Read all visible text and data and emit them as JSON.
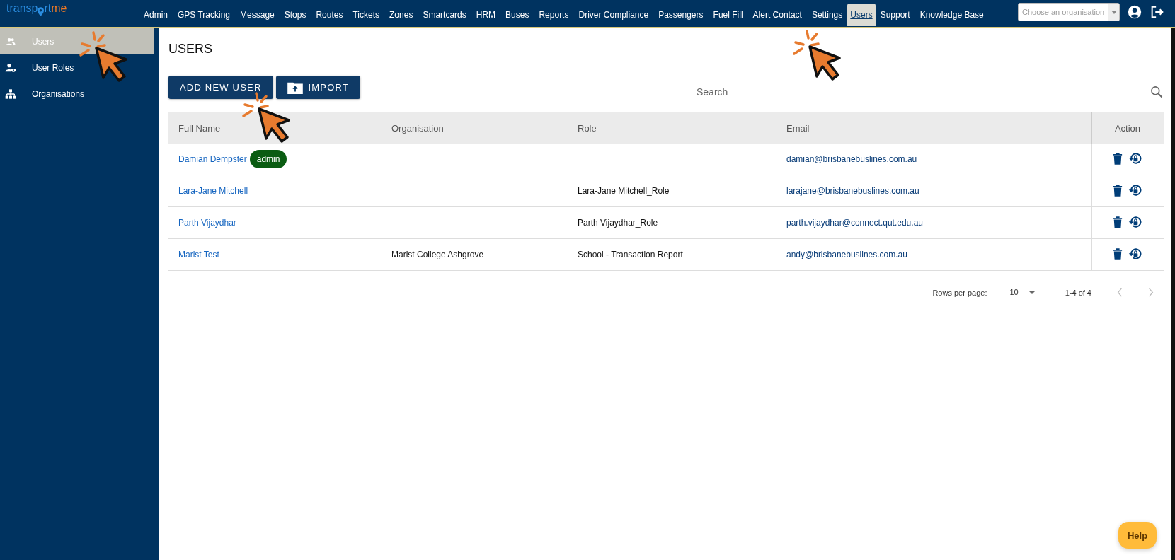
{
  "logo": {
    "part1": "transp",
    "part2": "rt",
    "part3": "me"
  },
  "nav": [
    {
      "label": "Admin",
      "selected": false
    },
    {
      "label": "GPS Tracking",
      "selected": false
    },
    {
      "label": "Message",
      "selected": false
    },
    {
      "label": "Stops",
      "selected": false
    },
    {
      "label": "Routes",
      "selected": false
    },
    {
      "label": "Tickets",
      "selected": false
    },
    {
      "label": "Zones",
      "selected": false
    },
    {
      "label": "Smartcards",
      "selected": false
    },
    {
      "label": "HRM",
      "selected": false
    },
    {
      "label": "Buses",
      "selected": false
    },
    {
      "label": "Reports",
      "selected": false
    },
    {
      "label": "Driver Compliance",
      "selected": false
    },
    {
      "label": "Passengers",
      "selected": false
    },
    {
      "label": "Fuel Fill",
      "selected": false
    },
    {
      "label": "Alert Contact",
      "selected": false
    },
    {
      "label": "Settings",
      "selected": false
    },
    {
      "label": "Users",
      "selected": true
    },
    {
      "label": "Support",
      "selected": false
    },
    {
      "label": "Knowledge Base",
      "selected": false
    }
  ],
  "org_select": {
    "placeholder": "Choose an organisation"
  },
  "sidebar": {
    "items": [
      {
        "label": "Users",
        "kind": "users",
        "selected": true
      },
      {
        "label": "User Roles",
        "kind": "roles",
        "selected": false
      },
      {
        "label": "Organisations",
        "kind": "orgs",
        "selected": false
      }
    ]
  },
  "page_title": "USERS",
  "buttons": {
    "add": "ADD NEW USER",
    "import": "IMPORT"
  },
  "search": {
    "placeholder": "Search"
  },
  "table": {
    "columns": [
      "Full Name",
      "Organisation",
      "Role",
      "Email",
      "Action"
    ],
    "rows": [
      {
        "name": "Damian Dempster",
        "badge": "admin",
        "organisation": "",
        "role": "",
        "email": "damian@brisbanebuslines.com.au"
      },
      {
        "name": "Lara-Jane Mitchell",
        "organisation": "",
        "role": "Lara-Jane Mitchell_Role",
        "email": "larajane@brisbanebuslines.com.au"
      },
      {
        "name": "Parth Vijaydhar",
        "organisation": "",
        "role": "Parth Vijaydhar_Role",
        "email": "parth.vijaydhar@connect.qut.edu.au"
      },
      {
        "name": "Marist Test",
        "organisation": "Marist College Ashgrove",
        "role": "School - Transaction Report",
        "email": "andy@brisbanebuslines.com.au"
      }
    ]
  },
  "pagination": {
    "label": "Rows per page:",
    "per_page": "10",
    "range": "1-4 of 4"
  },
  "help": "Help"
}
